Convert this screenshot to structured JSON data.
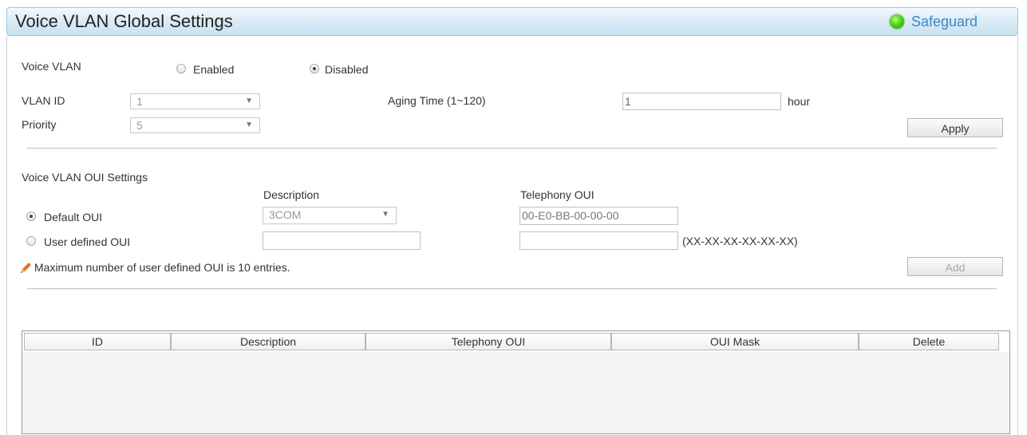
{
  "header": {
    "title": "Voice VLAN Global Settings",
    "status_label": "Safeguard"
  },
  "voice_vlan": {
    "label": "Voice VLAN",
    "enabled_label": "Enabled",
    "disabled_label": "Disabled",
    "selected": "Disabled"
  },
  "vlan_id": {
    "label": "VLAN ID",
    "value": "1"
  },
  "priority": {
    "label": "Priority",
    "value": "5"
  },
  "aging_time": {
    "label": "Aging Time (1~120)",
    "value": "1",
    "unit": "hour"
  },
  "apply_label": "Apply",
  "oui_settings": {
    "title": "Voice VLAN OUI Settings",
    "description_header": "Description",
    "telephony_header": "Telephony OUI",
    "default_oui_label": "Default OUI",
    "user_defined_label": "User defined OUI",
    "default_description": "3COM",
    "default_telephony_oui": "00-E0-BB-00-00-00",
    "user_description_value": "",
    "user_telephony_value": "",
    "format_hint": "(XX-XX-XX-XX-XX-XX)",
    "selected": "Default OUI",
    "note": "Maximum number of user defined OUI is 10 entries.",
    "add_label": "Add"
  },
  "table": {
    "columns": [
      "ID",
      "Description",
      "Telephony OUI",
      "OUI Mask",
      "Delete"
    ],
    "rows": []
  },
  "colors": {
    "accent": "#3a86c8",
    "safeguard_green": "#4fd21b"
  },
  "icons": {
    "note_icon": "pencil-icon",
    "safeguard_icon": "status-dot-icon"
  }
}
